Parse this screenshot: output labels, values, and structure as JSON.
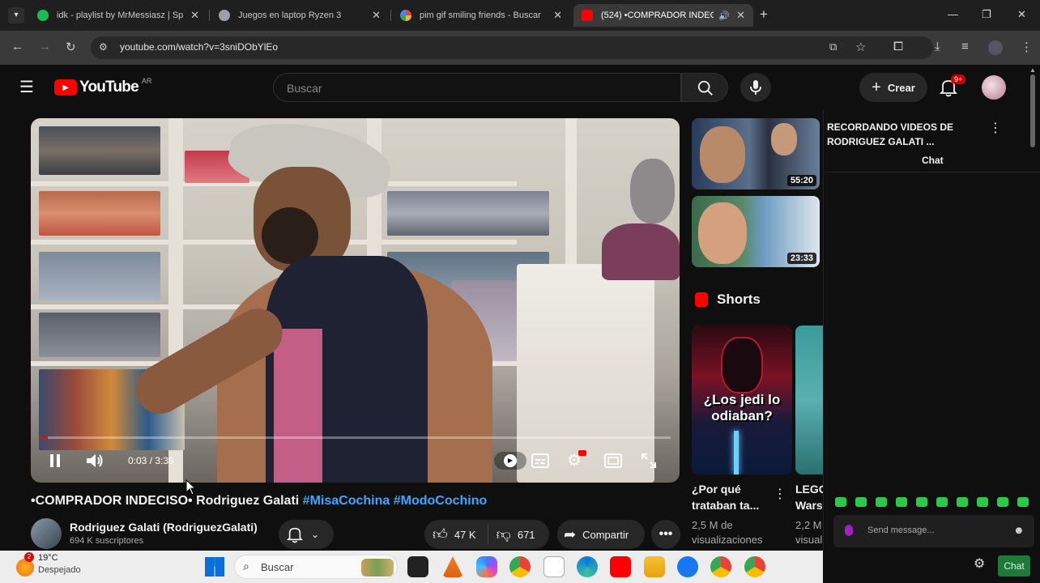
{
  "browser": {
    "tabs": [
      {
        "title": "idk - playlist by MrMessiasz | Sp",
        "active": false,
        "favicon_color": "#1db954"
      },
      {
        "title": "Juegos en laptop Ryzen 3",
        "active": false,
        "favicon_color": "#9aa0a6"
      },
      {
        "title": "pim gif smiling friends - Buscar",
        "active": false,
        "favicon_color": "#4285f4"
      },
      {
        "title": "(524) •COMPRADOR INDEC",
        "active": true,
        "favicon_color": "#ff0000"
      }
    ],
    "url": "youtube.com/watch?v=3sniDObYlEo"
  },
  "header": {
    "logo_text": "YouTube",
    "region": "AR",
    "search_placeholder": "Buscar",
    "create_label": "Crear",
    "notifications_badge": "9+"
  },
  "player": {
    "time": "0:03 / 3:39",
    "progress_percent": 1.4
  },
  "video": {
    "title_main": "•COMPRADOR INDECISO• Rodriguez Galati ",
    "hashtags": [
      "#MisaCochina",
      "#ModoCochino"
    ],
    "channel_name": "Rodriguez Galati (RodriguezGalati)",
    "subscribers": "694 K suscriptores",
    "likes": "47 K",
    "dislikes": "671",
    "share_label": "Compartir"
  },
  "recommendations": [
    {
      "duration": "55:20"
    },
    {
      "duration": "23:33"
    }
  ],
  "shorts": {
    "heading": "Shorts",
    "items": [
      {
        "title": "¿Por qué trataban ta...",
        "views": "2,5 M de visualizaciones",
        "thumb_text": "¿Los jedi lo odiaban?"
      },
      {
        "title": "LEGO Wars",
        "views": "2,2 M visual"
      }
    ]
  },
  "chat": {
    "header": "RECORDANDO VIDEOS DE RODRIGUEZ GALATI ...",
    "tab_label": "Chat",
    "input_placeholder": "Send message...",
    "chat_button": "Chat"
  },
  "taskbar": {
    "weather_temp": "19°C",
    "weather_desc": "Despejado",
    "weather_badge": "2",
    "search_placeholder": "Buscar"
  }
}
